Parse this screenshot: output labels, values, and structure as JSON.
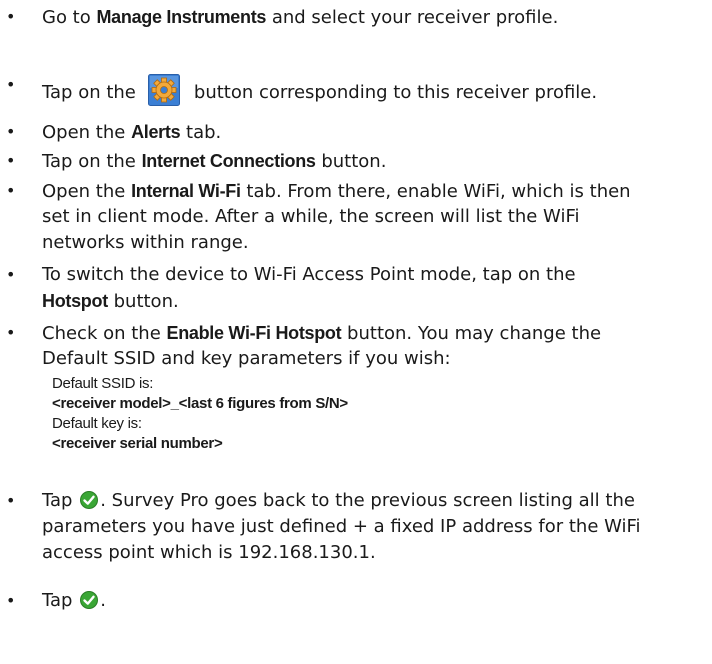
{
  "bullet_char": "•",
  "steps": [
    {
      "pre": "Go to ",
      "bold": "Manage Instruments",
      "post": " and select your receiver profile."
    },
    {
      "pre": "Tap on the",
      "post": "button corresponding to this receiver profile.",
      "icon": "gear-settings-icon"
    },
    {
      "pre": "Open the ",
      "bold": "Alerts",
      "post": " tab."
    },
    {
      "pre": "Tap on the ",
      "bold": "Internet Connections",
      "post": " button."
    },
    {
      "pre": "Open the ",
      "bold": "Internal Wi-Fi",
      "post": " tab. From there, enable WiFi, which is then",
      "cont": [
        "set in client mode. After a while, the screen will list the WiFi",
        "networks within range."
      ]
    },
    {
      "pre": "To switch the device to Wi-Fi Access Point mode, tap on the",
      "cont_bold": "Hotspot",
      "cont_post": " button."
    },
    {
      "pre": "Check on the ",
      "bold": "Enable Wi-Fi Hotspot",
      "post": " button. You may change the",
      "cont": [
        "Default SSID and key parameters if you wish:"
      ]
    },
    {
      "pre": "Tap ",
      "post": ". Survey Pro goes back to the previous screen listing all the",
      "icon": "green-check-icon",
      "cont": [
        "parameters you have just defined + a fixed IP address for the WiFi",
        "access point which is 192.168.130.1."
      ]
    },
    {
      "pre": "Tap ",
      "post": ".",
      "icon": "green-check-icon"
    }
  ],
  "defaults": {
    "ssid_label": "Default SSID is:",
    "ssid_value": "<receiver model>_<last 6 figures from S/N>",
    "key_label": "Default key is:",
    "key_value": "<receiver serial number>"
  },
  "colors": {
    "gear_bg": "#3b7fd4",
    "gear_fg": "#f2a93b",
    "check_bg": "#3aa635"
  }
}
